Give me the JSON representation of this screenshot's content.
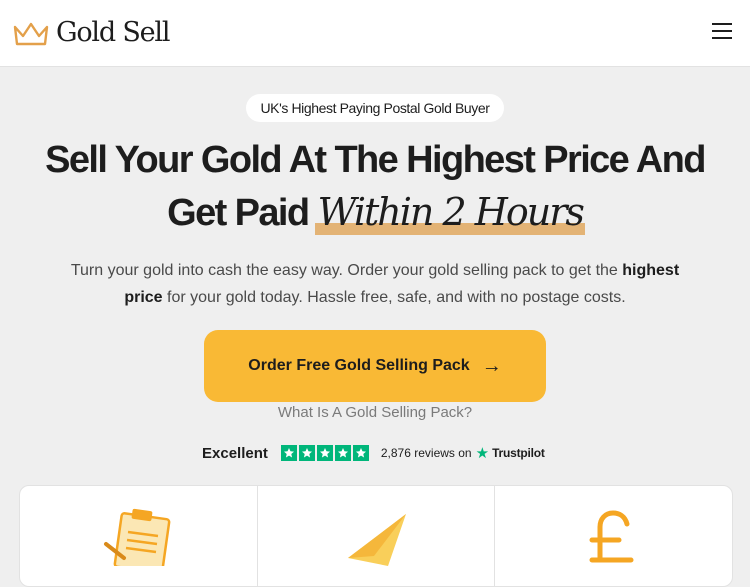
{
  "header": {
    "brand": "Gold Sell",
    "logo_icon": "crown-icon",
    "menu_icon": "hamburger-menu-icon"
  },
  "hero": {
    "badge": "UK's Highest Paying Postal Gold Buyer",
    "headline_line1": "Sell Your Gold At The Highest Price And",
    "headline_line2_prefix": "Get Paid",
    "headline_line2_highlight": "Within 2 Hours",
    "subtext_part1": "Turn your gold into cash the easy way. Order your gold selling pack to get the ",
    "subtext_bold": "highest price",
    "subtext_part2": " for your gold today. Hassle free, safe, and with no postage costs.",
    "cta_label": "Order Free Gold Selling Pack",
    "cta_icon": "arrow-right-icon",
    "secondary_link": "What Is A Gold Selling Pack?"
  },
  "trustpilot": {
    "rating_word": "Excellent",
    "stars": 5,
    "review_count": "2,876",
    "reviews_on": "reviews on",
    "platform": "Trustpilot"
  },
  "cards": [
    {
      "icon": "clipboard-icon"
    },
    {
      "icon": "paper-plane-icon"
    },
    {
      "icon": "pound-sign-icon"
    }
  ],
  "colors": {
    "accent": "#f9b935",
    "highlight": "#e3b375",
    "trustpilot_green": "#00b67a",
    "background": "#efefef"
  }
}
